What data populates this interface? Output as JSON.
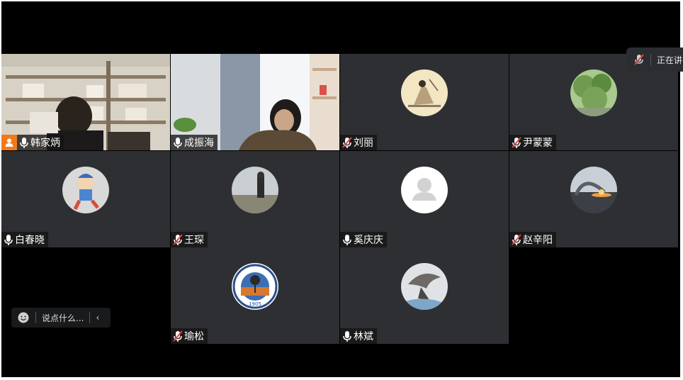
{
  "participants": [
    {
      "name": "韩家炳",
      "mic": "on",
      "host": true,
      "active": true
    },
    {
      "name": "成振海",
      "mic": "on"
    },
    {
      "name": "刘丽",
      "mic": "muted"
    },
    {
      "name": "尹蒙蒙",
      "mic": "muted"
    },
    {
      "name": "白春晓",
      "mic": "on"
    },
    {
      "name": "王琛",
      "mic": "muted"
    },
    {
      "name": "奚庆庆",
      "mic": "on"
    },
    {
      "name": "赵辛阳",
      "mic": "muted"
    },
    {
      "name": "瑜松",
      "mic": "muted"
    },
    {
      "name": "林斌",
      "mic": "on"
    }
  ],
  "speaking_indicator": {
    "label": "正在讲",
    "icon": "muted-mic-icon"
  },
  "chat": {
    "placeholder": "说点什么...",
    "collapse_icon": "chevron-left-icon",
    "emoji_icon": "emoji-icon"
  },
  "colors": {
    "tile_bg": "#2d2f33",
    "active_border": "#2fb24c",
    "host_badge": "#f07a1a",
    "muted_mic": "#e04040"
  }
}
